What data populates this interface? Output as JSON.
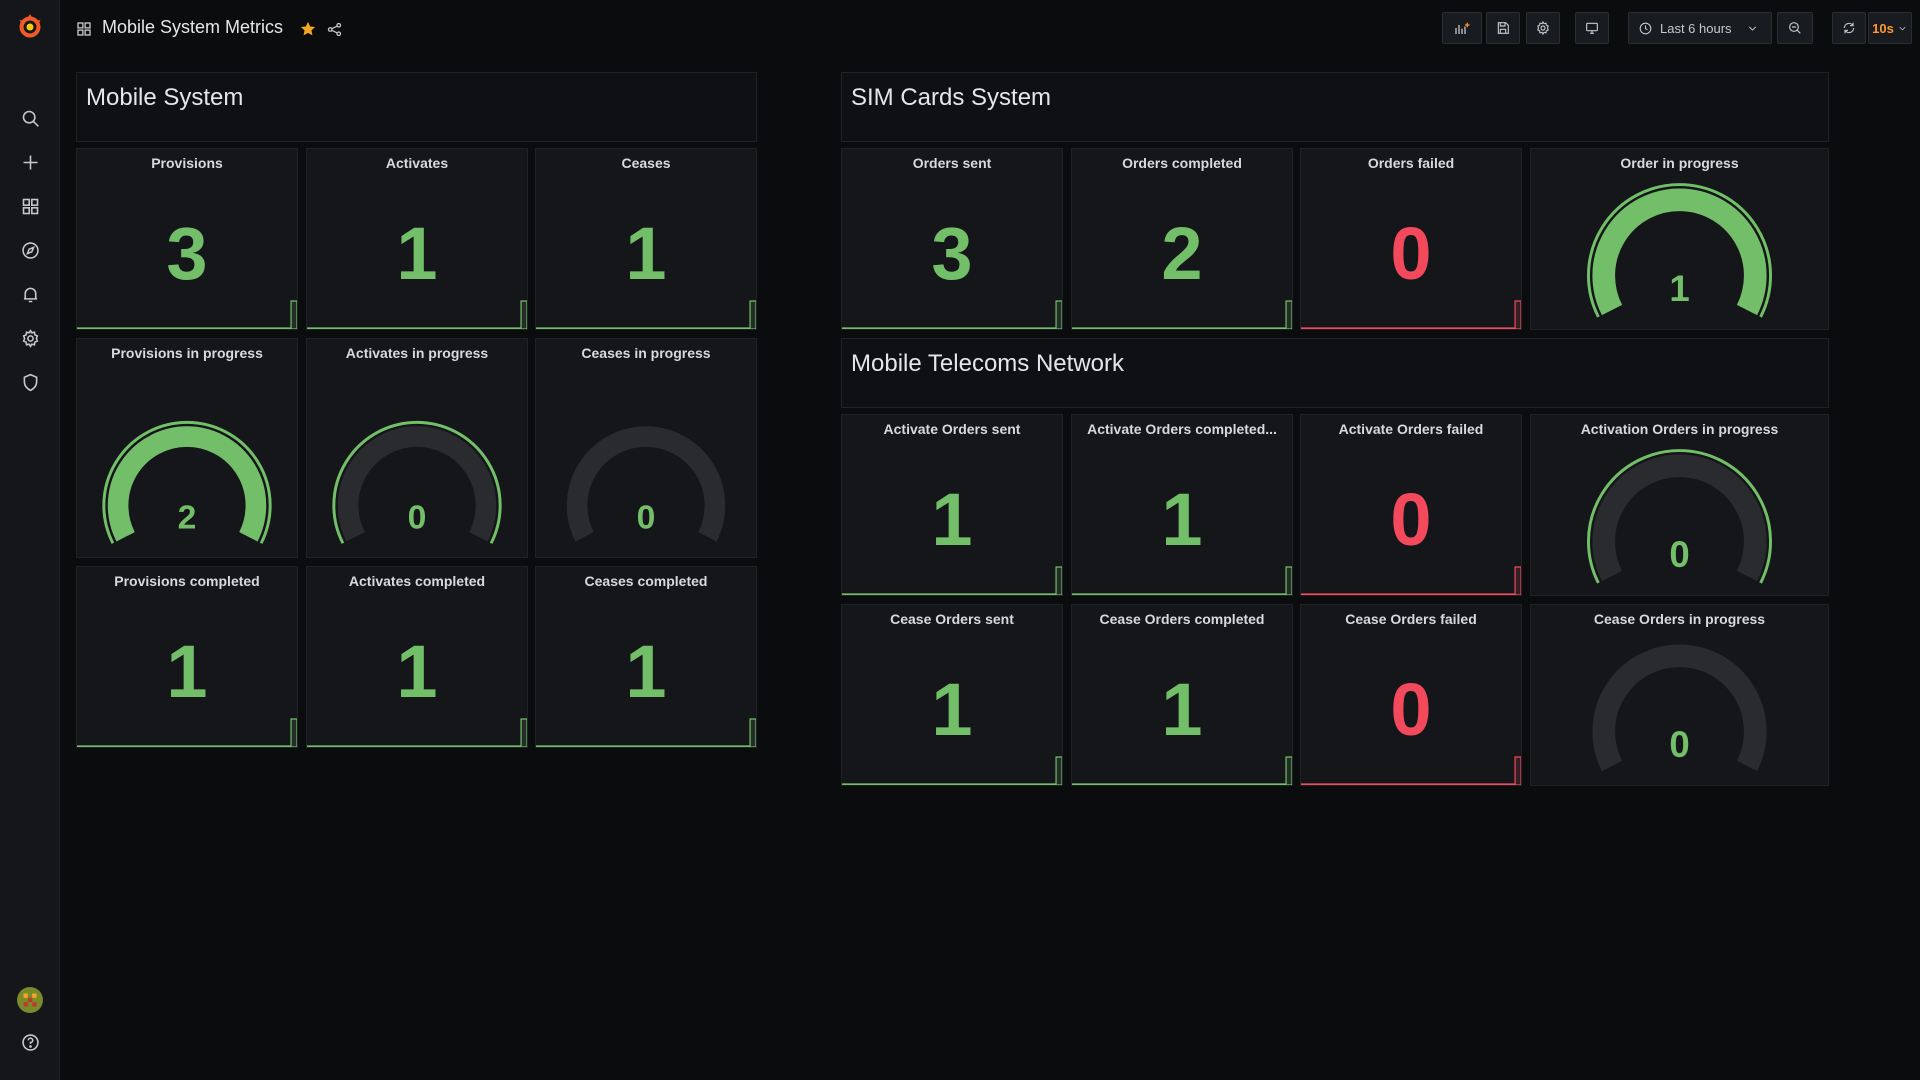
{
  "dashboard": {
    "title": "Mobile System Metrics"
  },
  "toolbar": {
    "time_range": "Last 6 hours",
    "refresh": "10s"
  },
  "colors": {
    "green": "#73bf69",
    "red": "#f2495c",
    "gauge_track": "#2a2b2e",
    "star": "#f5a623",
    "accent": "#ff9830"
  },
  "rows": [
    {
      "id": "mobile_system",
      "title": "Mobile System"
    },
    {
      "id": "sim_cards",
      "title": "SIM Cards System"
    },
    {
      "id": "telecoms",
      "title": "Mobile Telecoms Network"
    }
  ],
  "panels": [
    {
      "id": "provisions",
      "title": "Provisions",
      "kind": "stat",
      "value": "3",
      "color": "green"
    },
    {
      "id": "activates",
      "title": "Activates",
      "kind": "stat",
      "value": "1",
      "color": "green"
    },
    {
      "id": "ceases",
      "title": "Ceases",
      "kind": "stat",
      "value": "1",
      "color": "green"
    },
    {
      "id": "provisions_ip",
      "title": "Provisions in progress",
      "kind": "gauge",
      "value": "2",
      "fill": 1.0
    },
    {
      "id": "activates_ip",
      "title": "Activates in progress",
      "kind": "gauge",
      "value": "0",
      "fill": 0.0,
      "ring": true
    },
    {
      "id": "ceases_ip",
      "title": "Ceases in progress",
      "kind": "gauge",
      "value": "0",
      "fill": 0.0,
      "ring": false
    },
    {
      "id": "provisions_done",
      "title": "Provisions completed",
      "kind": "stat",
      "value": "1",
      "color": "green"
    },
    {
      "id": "activates_done",
      "title": "Activates completed",
      "kind": "stat",
      "value": "1",
      "color": "green"
    },
    {
      "id": "ceases_done",
      "title": "Ceases completed",
      "kind": "stat",
      "value": "1",
      "color": "green"
    },
    {
      "id": "orders_sent",
      "title": "Orders sent",
      "kind": "stat",
      "value": "3",
      "color": "green"
    },
    {
      "id": "orders_completed",
      "title": "Orders completed",
      "kind": "stat",
      "value": "2",
      "color": "green"
    },
    {
      "id": "orders_failed",
      "title": "Orders failed",
      "kind": "stat",
      "value": "0",
      "color": "red"
    },
    {
      "id": "order_ip",
      "title": "Order in progress",
      "kind": "gauge",
      "value": "1",
      "fill": 1.0
    },
    {
      "id": "act_sent",
      "title": "Activate Orders sent",
      "kind": "stat",
      "value": "1",
      "color": "green"
    },
    {
      "id": "act_completed",
      "title": "Activate Orders completed...",
      "kind": "stat",
      "value": "1",
      "color": "green"
    },
    {
      "id": "act_failed",
      "title": "Activate Orders failed",
      "kind": "stat",
      "value": "0",
      "color": "red"
    },
    {
      "id": "act_ip",
      "title": "Activation Orders in progress",
      "kind": "gauge",
      "value": "0",
      "fill": 0.0,
      "ring": true
    },
    {
      "id": "cease_sent",
      "title": "Cease Orders sent",
      "kind": "stat",
      "value": "1",
      "color": "green"
    },
    {
      "id": "cease_completed",
      "title": "Cease Orders completed",
      "kind": "stat",
      "value": "1",
      "color": "green"
    },
    {
      "id": "cease_failed",
      "title": "Cease Orders failed",
      "kind": "stat",
      "value": "0",
      "color": "red"
    },
    {
      "id": "cease_ip",
      "title": "Cease Orders in progress",
      "kind": "gauge",
      "value": "0",
      "fill": 0.0,
      "ring": false
    }
  ],
  "sidemenu": [
    "grafana-logo-icon",
    "search-icon",
    "plus-icon",
    "dashboards-icon",
    "explore-icon",
    "alerting-icon",
    "configuration-icon",
    "shield-icon",
    "user-avatar",
    "help-icon"
  ]
}
